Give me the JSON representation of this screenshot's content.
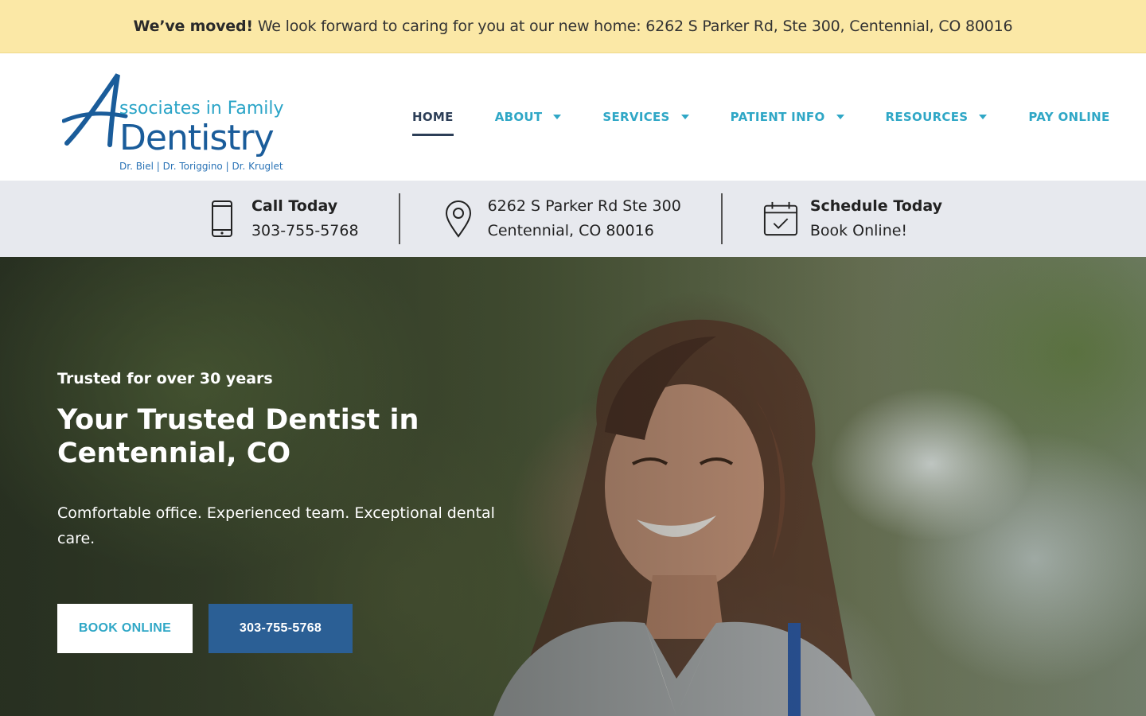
{
  "announcement": {
    "bold": "We’ve moved!",
    "text": "We look forward to caring for you at our new home: 6262 S Parker Rd, Ste 300, Centennial, CO 80016"
  },
  "logo": {
    "top_line": "ssociates in Family",
    "main_line": "Dentistry",
    "doctors": "Dr. Biel | Dr. Toriggino | Dr. Kruglet"
  },
  "nav": {
    "items": [
      {
        "label": "HOME",
        "active": true,
        "dropdown": false
      },
      {
        "label": "ABOUT",
        "active": false,
        "dropdown": true
      },
      {
        "label": "SERVICES",
        "active": false,
        "dropdown": true
      },
      {
        "label": "PATIENT INFO",
        "active": false,
        "dropdown": true
      },
      {
        "label": "RESOURCES",
        "active": false,
        "dropdown": true
      },
      {
        "label": "PAY ONLINE",
        "active": false,
        "dropdown": false
      }
    ]
  },
  "infobar": {
    "call": {
      "title": "Call Today",
      "value": "303-755-5768",
      "icon": "phone-icon"
    },
    "address": {
      "line1": "6262 S Parker Rd Ste 300",
      "line2": "Centennial, CO 80016",
      "icon": "map-pin-icon"
    },
    "schedule": {
      "title": "Schedule Today",
      "value": "Book Online!",
      "icon": "calendar-check-icon"
    }
  },
  "hero": {
    "kicker": "Trusted for over 30 years",
    "title_line1": "Your Trusted Dentist in",
    "title_line2": "Centennial, CO",
    "subtitle": "Comfortable office. Experienced team. Exceptional dental care.",
    "book_button": "BOOK ONLINE",
    "phone_button": "303-755-5768"
  },
  "colors": {
    "accent": "#2fa7c6",
    "navy": "#2c3e57",
    "button_blue": "#2b5f95",
    "banner": "#fbe8a6"
  }
}
